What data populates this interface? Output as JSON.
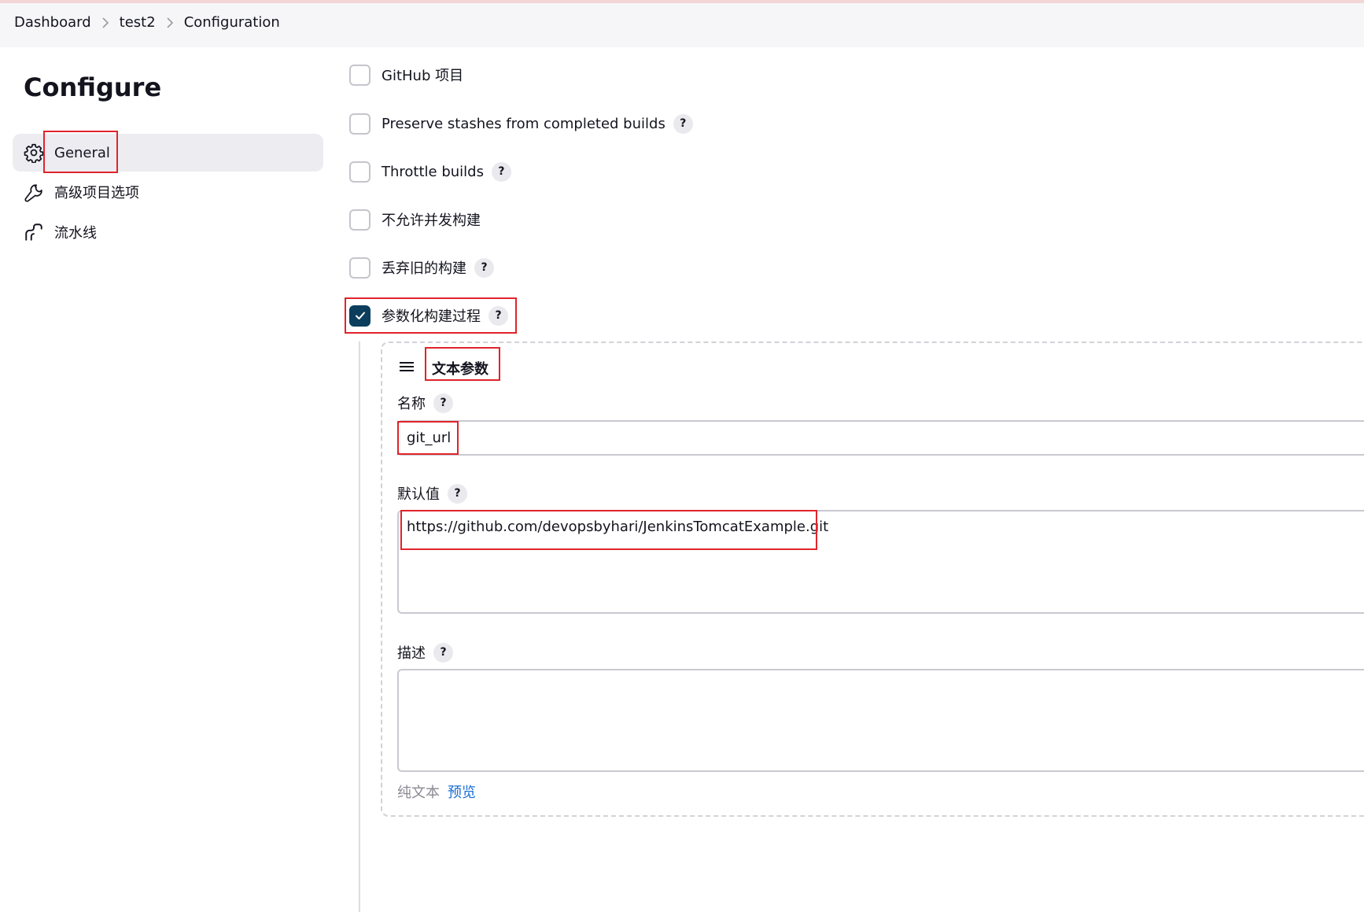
{
  "breadcrumb": {
    "items": [
      "Dashboard",
      "test2",
      "Configuration"
    ]
  },
  "sidebar": {
    "title": "Configure",
    "items": [
      {
        "label": "General",
        "icon": "gear-icon",
        "active": true
      },
      {
        "label": "高级项目选项",
        "icon": "wrench-icon",
        "active": false
      },
      {
        "label": "流水线",
        "icon": "pipeline-icon",
        "active": false
      }
    ]
  },
  "options": [
    {
      "label": "GitHub 项目",
      "checked": false,
      "help": false
    },
    {
      "label": "Preserve stashes from completed builds",
      "checked": false,
      "help": true
    },
    {
      "label": "Throttle builds",
      "checked": false,
      "help": true
    },
    {
      "label": "不允许并发构建",
      "checked": false,
      "help": false
    },
    {
      "label": "丢弃旧的构建",
      "checked": false,
      "help": true
    },
    {
      "label": "参数化构建过程",
      "checked": true,
      "help": true
    }
  ],
  "help_glyph": "?",
  "parameter": {
    "type_title": "文本参数",
    "name_label": "名称",
    "name_value": "git_url",
    "default_label": "默认值",
    "default_value": "https://github.com/devopsbyhari/JenkinsTomcatExample.git",
    "description_label": "描述",
    "description_value": "",
    "plain_text_label": "纯文本",
    "preview_label": "预览"
  },
  "colors": {
    "accent_checked": "#0b3d5c",
    "highlight_box": "#e0242c",
    "link": "#1b6fd6"
  }
}
